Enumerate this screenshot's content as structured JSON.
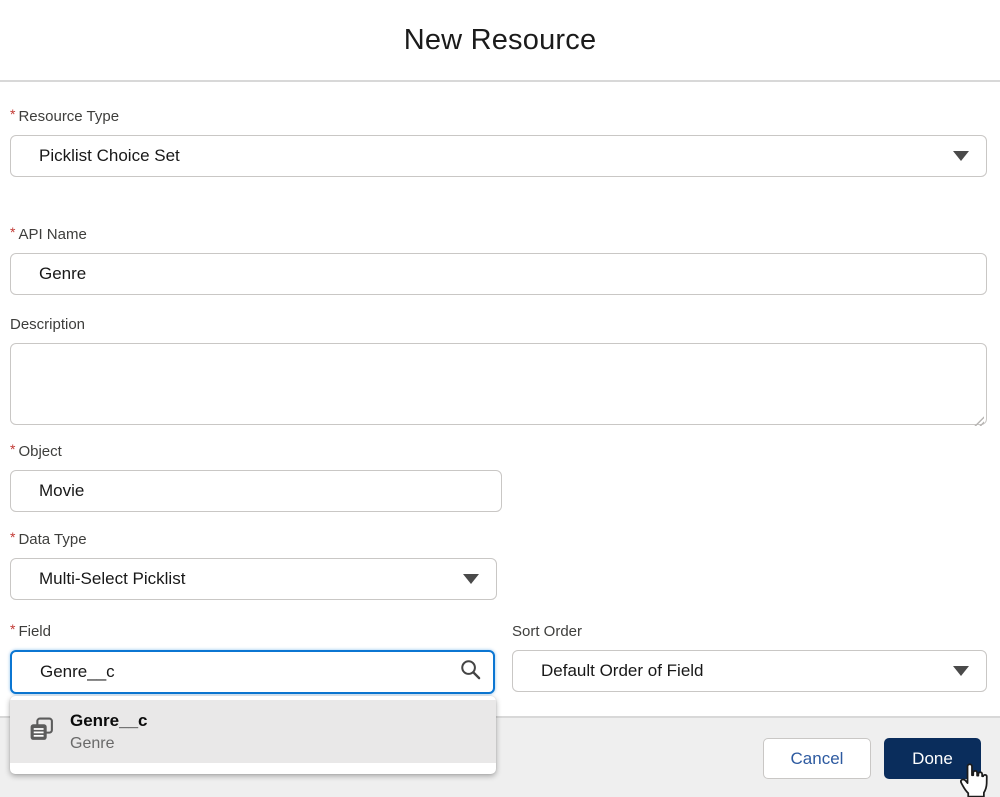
{
  "modal": {
    "title": "New Resource"
  },
  "fields": {
    "resource_type": {
      "label": "Resource Type",
      "required_mark": "*",
      "value": "Picklist Choice Set"
    },
    "api_name": {
      "label": "API Name",
      "required_mark": "*",
      "value": "Genre"
    },
    "description": {
      "label": "Description",
      "value": ""
    },
    "object": {
      "label": "Object",
      "required_mark": "*",
      "value": "Movie"
    },
    "data_type": {
      "label": "Data Type",
      "required_mark": "*",
      "value": "Multi-Select Picklist"
    },
    "field": {
      "label": "Field",
      "required_mark": "*",
      "value": "Genre__c"
    },
    "sort_order": {
      "label": "Sort Order",
      "value": "Default Order of Field"
    }
  },
  "field_suggestions": {
    "items": [
      {
        "title": "Genre__c",
        "subtitle": "Genre",
        "icon": "picklist-type-icon"
      }
    ]
  },
  "footer": {
    "cancel_label": "Cancel",
    "done_label": "Done"
  },
  "icons": {
    "field_search": "search-icon",
    "resource_type_dropdown": "chevron-down-icon",
    "data_type_dropdown": "chevron-down-icon",
    "sort_order_dropdown": "chevron-down-icon",
    "suggestion_item": "picklist-type-icon",
    "pointer": "hand-pointer-cursor"
  },
  "colors": {
    "focus_border": "#0b76d2",
    "brand_navy": "#0a2d5c",
    "cancel_text": "#2d5aa0",
    "required_red": "#c23934",
    "footer_bg": "#efefef",
    "suggestion_hover_bg": "#e9e8e8",
    "divider": "#d8d8d8"
  }
}
